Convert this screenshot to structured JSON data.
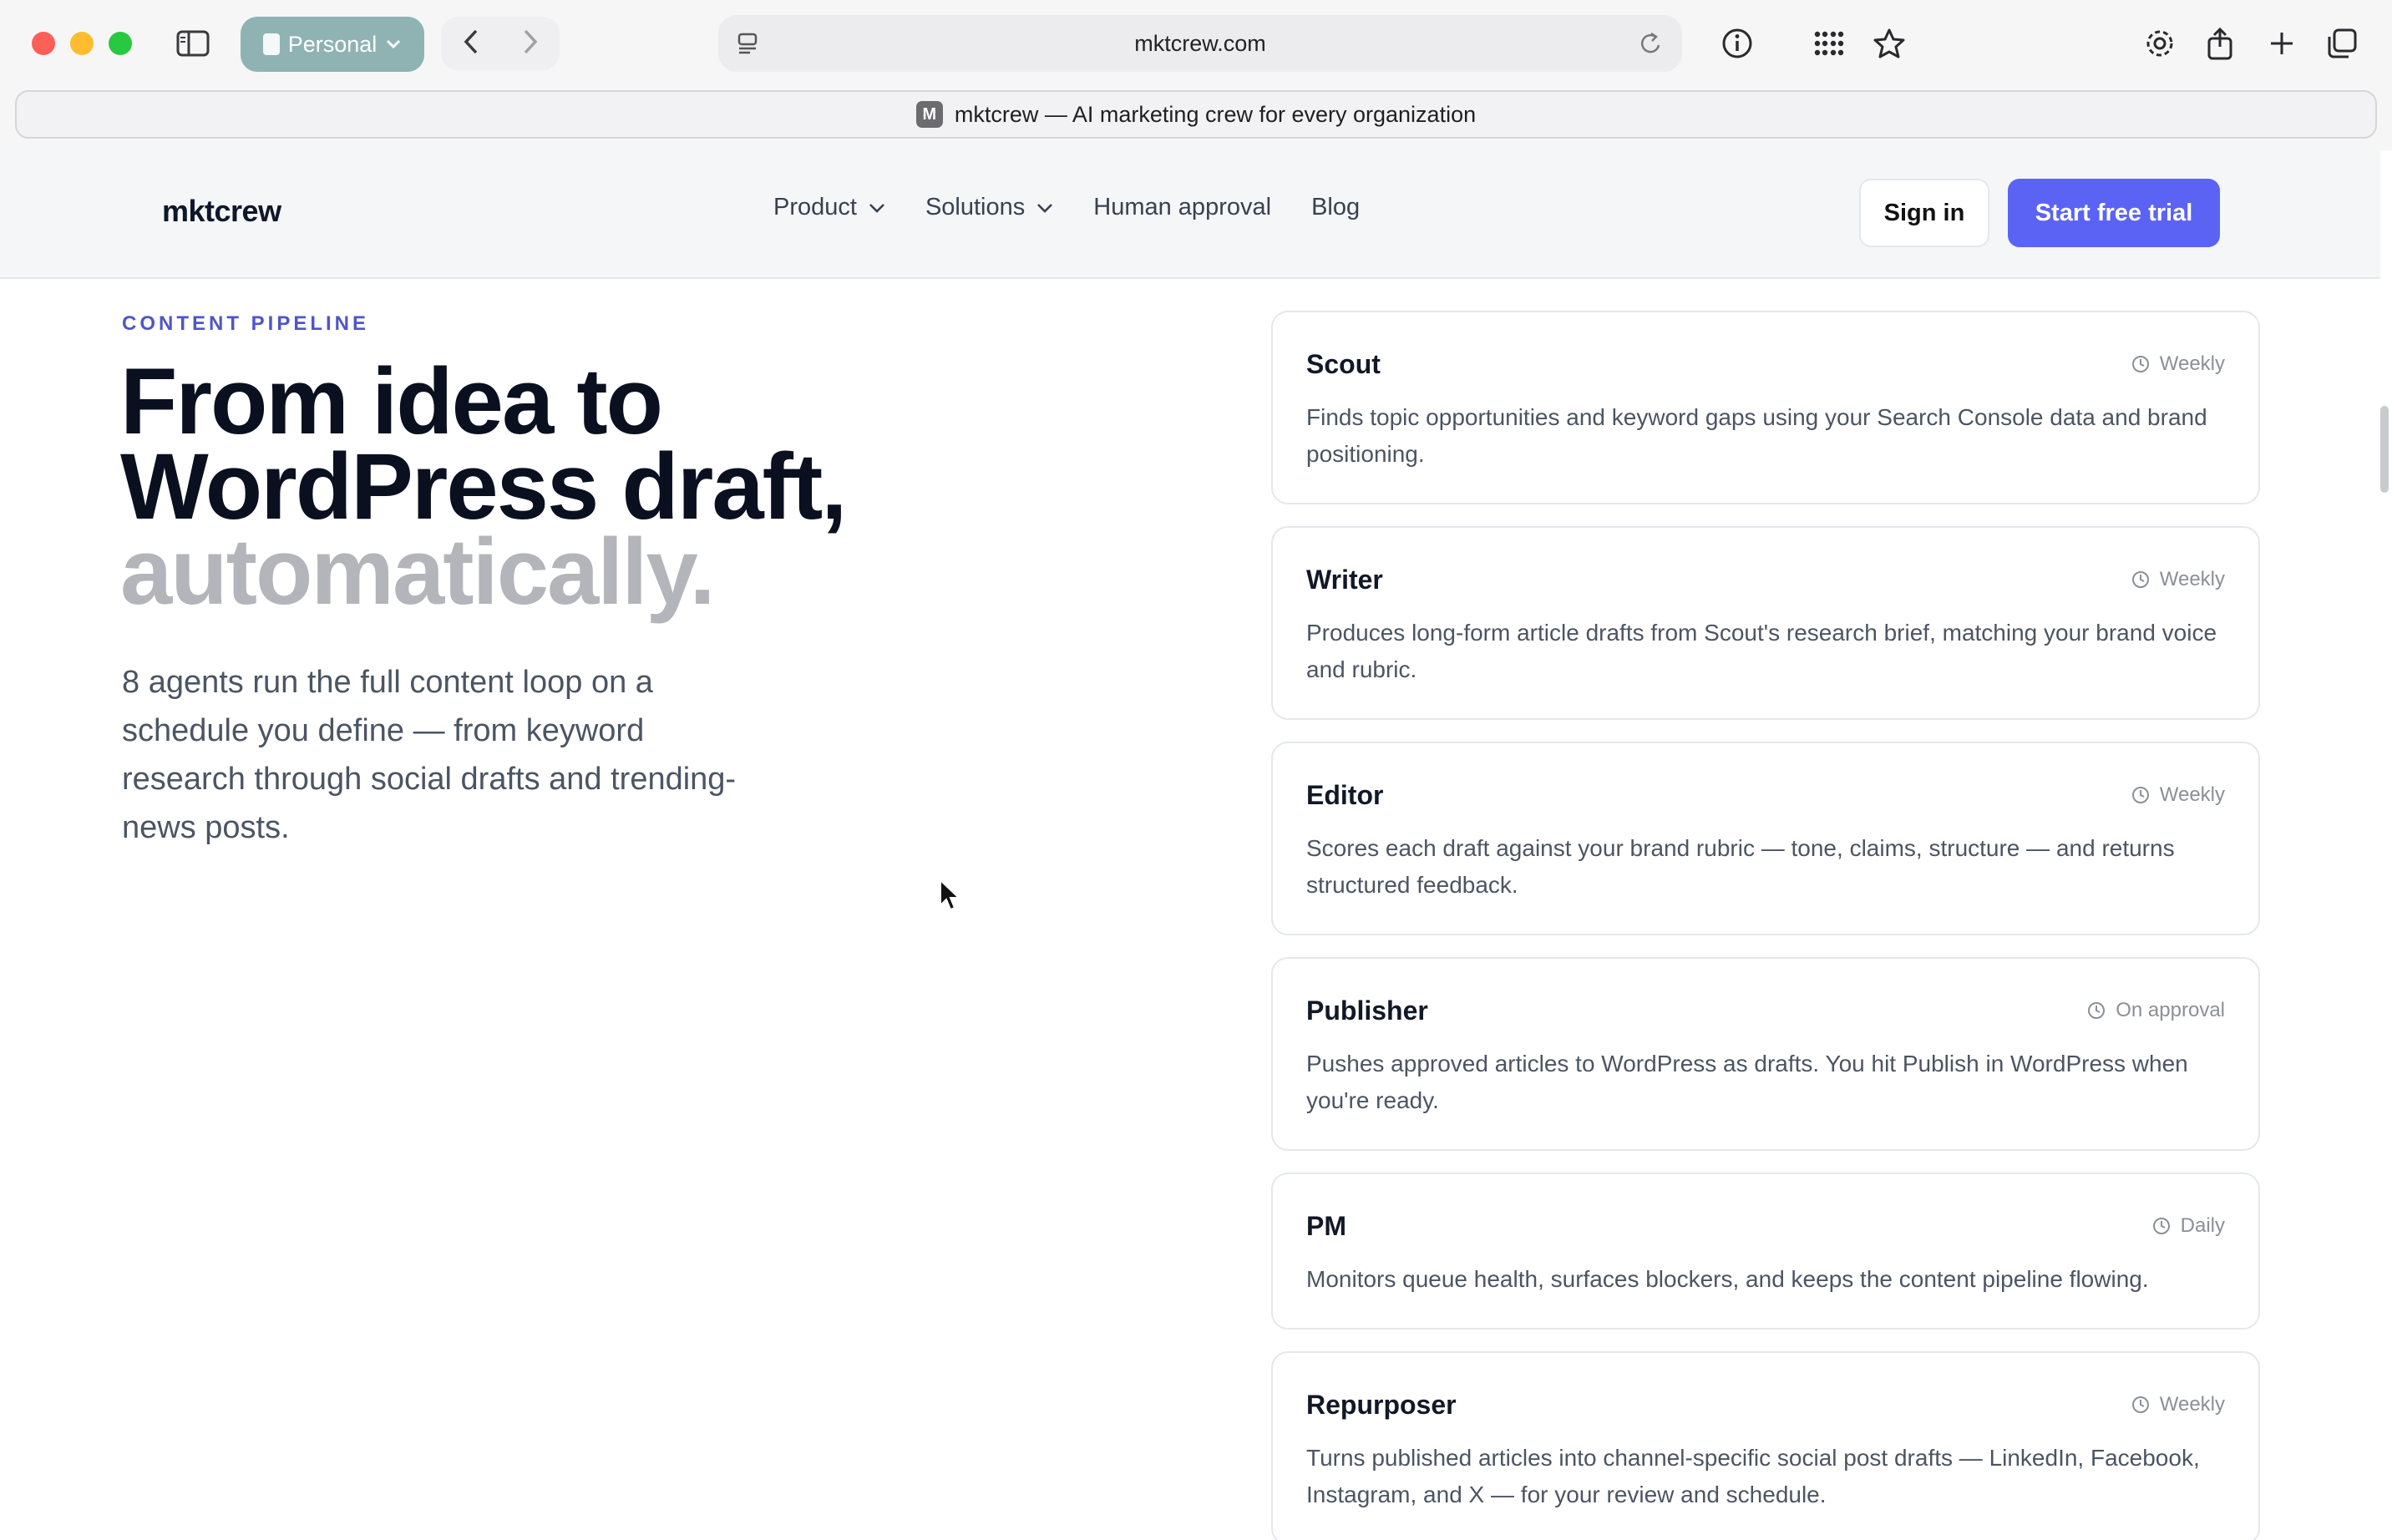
{
  "browser": {
    "profile_label": "Personal",
    "url": "mktcrew.com",
    "tab_favicon_letter": "M",
    "tab_title": "mktcrew — AI marketing crew for every organization"
  },
  "header": {
    "logo": "mktcrew",
    "nav": {
      "product": "Product",
      "solutions": "Solutions",
      "human_approval": "Human approval",
      "blog": "Blog"
    },
    "sign_in": "Sign in",
    "start_trial": "Start free trial"
  },
  "hero": {
    "eyebrow": "CONTENT PIPELINE",
    "headline_line1": "From idea to",
    "headline_line2": "WordPress draft,",
    "headline_line3": "automatically.",
    "lede": "8 agents run the full content loop on a schedule you define — from keyword research through social drafts and trending-news posts."
  },
  "agents": [
    {
      "name": "Scout",
      "schedule": "Weekly",
      "description": "Finds topic opportunities and keyword gaps using your Search Console data and brand positioning."
    },
    {
      "name": "Writer",
      "schedule": "Weekly",
      "description": "Produces long-form article drafts from Scout's research brief, matching your brand voice and rubric."
    },
    {
      "name": "Editor",
      "schedule": "Weekly",
      "description": "Scores each draft against your brand rubric — tone, claims, structure — and returns structured feedback."
    },
    {
      "name": "Publisher",
      "schedule": "On approval",
      "description": "Pushes approved articles to WordPress as drafts. You hit Publish in WordPress when you're ready."
    },
    {
      "name": "PM",
      "schedule": "Daily",
      "description": "Monitors queue health, surfaces blockers, and keeps the content pipeline flowing."
    },
    {
      "name": "Repurposer",
      "schedule": "Weekly",
      "description": "Turns published articles into channel-specific social post drafts — LinkedIn, Facebook, Instagram, and X — for your review and schedule."
    }
  ],
  "colors": {
    "accent": "#5b63f5",
    "eyebrow": "#4f55c8",
    "headline": "#0b1020",
    "headline_muted": "#b4b5ba"
  }
}
